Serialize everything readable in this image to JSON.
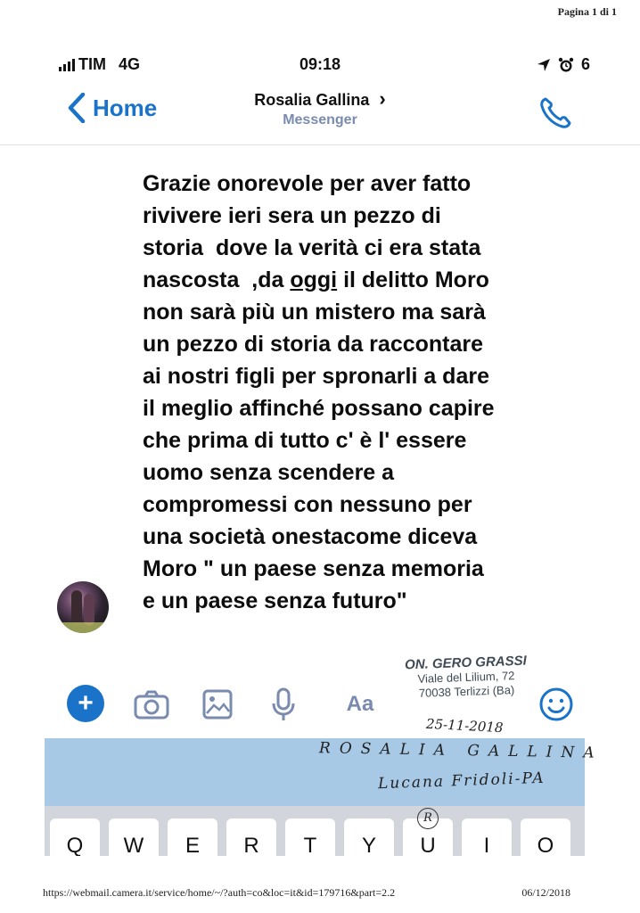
{
  "print": {
    "page_label": "Pagina 1 di 1",
    "url": "https://webmail.camera.it/service/home/~/?auth=co&loc=it&id=179716&part=2.2",
    "date": "06/12/2018"
  },
  "status_bar": {
    "carrier": "TIM",
    "network": "4G",
    "time": "09:18",
    "battery": "6"
  },
  "nav": {
    "back_label": "Home",
    "contact_name": "Rosalia Gallina",
    "contact_chevron": "›",
    "app_label": "Messenger",
    "accent_color": "#1a73c9"
  },
  "message": {
    "lines": [
      "Grazie onorevole per aver fatto",
      "rivivere ieri sera un pezzo di",
      "storia  dove la verità ci era stata",
      "il delitto Moro",
      "non sarà più un mistero ma sarà",
      "un pezzo di storia da raccontare",
      "ai nostri figli per spronarli a dare",
      "il meglio affinché possano capire",
      "che prima di tutto c' è l' essere",
      "uomo senza scendere a",
      "compromessi con nessuno per",
      "una società onestacome diceva",
      "Moro \" un paese senza memoria",
      "e un paese senza futuro\""
    ],
    "line4_prefix": "nascosta  ,da ",
    "line4_underlined": "oggi",
    "line4_suffix": " il delitto Moro"
  },
  "stamp": {
    "name": "ON. GERO GRASSI",
    "address": "Viale del Lilium, 72",
    "city": "70038 Terlizzi (Ba)"
  },
  "toolbar": {
    "plus": "+",
    "text_label": "Aa"
  },
  "handwriting": {
    "date": "25-11-2018",
    "name": "ROSALIA GALLINA",
    "sub": "Lucana Fridoli-PA",
    "mark": "R"
  },
  "keyboard": {
    "keys": [
      "Q",
      "W",
      "E",
      "R",
      "T",
      "Y",
      "U",
      "I",
      "O"
    ]
  }
}
